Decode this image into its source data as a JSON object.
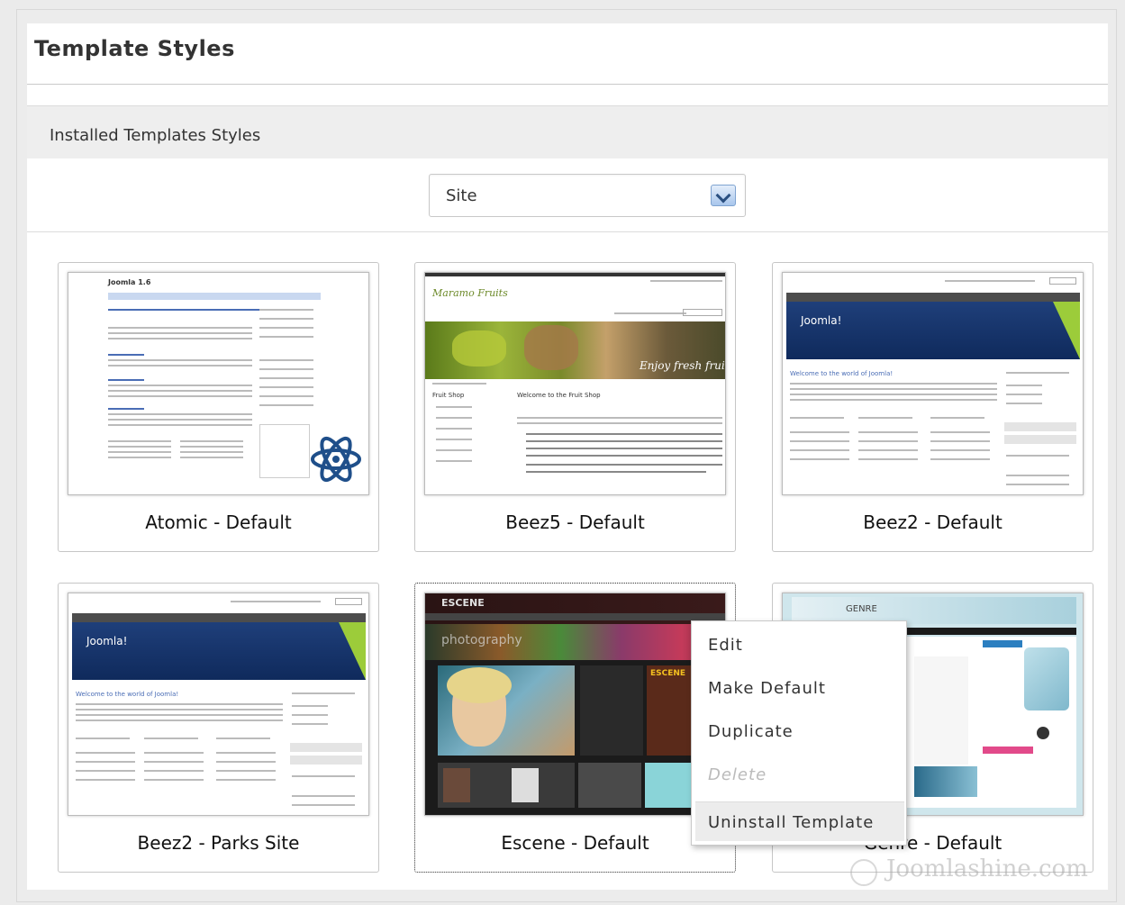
{
  "page": {
    "title": "Template Styles"
  },
  "section": {
    "heading": "Installed Templates Styles"
  },
  "filter": {
    "selected": "Site"
  },
  "templates": [
    {
      "caption": "Atomic - Default"
    },
    {
      "caption": "Beez5 - Default"
    },
    {
      "caption": "Beez2 - Default"
    },
    {
      "caption": "Beez2 - Parks Site"
    },
    {
      "caption": "Escene - Default"
    },
    {
      "caption": "Genre - Default"
    }
  ],
  "thumbs": {
    "atomic": {
      "title": "Joomla 1.6"
    },
    "beez5": {
      "brand": "Maramo Fruits",
      "banner": "Enjoy fresh fruits",
      "heading": "Welcome to the Fruit Shop",
      "side": "Fruit Shop"
    },
    "beez2": {
      "logo": "Joomla!",
      "welcome": "Welcome to the world of Joomla!"
    },
    "parks": {
      "logo": "Joomla!",
      "welcome": "Welcome to the world of Joomla!"
    },
    "escene": {
      "logo": "ESCENE",
      "banner": "photography",
      "side": "ESCENE"
    },
    "genre": {
      "logo": "GENRE"
    }
  },
  "context_menu": {
    "items": [
      "Edit",
      "Make Default",
      "Duplicate",
      "Delete",
      "Uninstall Template"
    ]
  },
  "watermark": {
    "text": "Joomlashine.com"
  },
  "colors": {
    "accent": "#4a6db5",
    "joomla_blue": "#1f3f7a",
    "select_arrow": "#a8c6ec"
  }
}
